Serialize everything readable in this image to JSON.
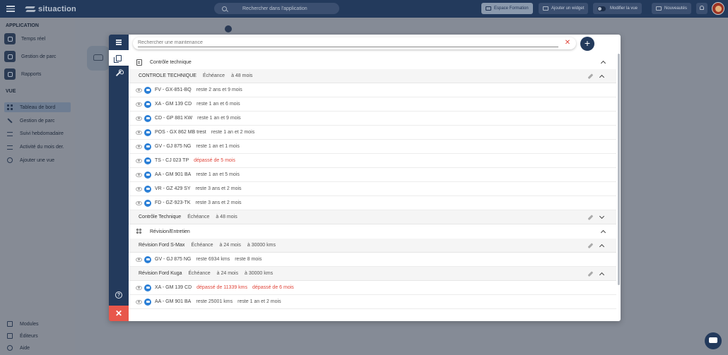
{
  "header": {
    "brand": "situaction",
    "search_placeholder": "Rechercher dans l'application",
    "buttons": {
      "training": "Espace Formation",
      "add_widget": "Ajouter un widget",
      "edit_view": "Modifier la vue",
      "news": "Nouveautés"
    }
  },
  "sidebar": {
    "application_title": "APPLICATION",
    "application_items": [
      "Temps réel",
      "Gestion de parc",
      "Rapports"
    ],
    "view_title": "VUE",
    "view_items": [
      "Tableau de bord",
      "Gestion de parc",
      "Suivi hebdomadaire",
      "Activité du mois der.",
      "Ajouter une vue"
    ],
    "bottom_items": [
      "Modules",
      "Éditeurs",
      "Aide"
    ]
  },
  "modal": {
    "search_placeholder": "Rechercher une maintenance",
    "groups": [
      {
        "title": "Contrôle technique",
        "maintenances": [
          {
            "name": "CONTROLE TECHNIQUE",
            "due_label": "Échéance",
            "due": [
              "à 48 mois"
            ],
            "vehicles": [
              {
                "plate": "FV - GX-851-BQ",
                "status": [
                  "reste 2 ans et 9 mois"
                ],
                "overdue": [
                  false
                ]
              },
              {
                "plate": "XA - GM 139 CD",
                "status": [
                  "reste 1 an et 6 mois"
                ],
                "overdue": [
                  false
                ]
              },
              {
                "plate": "CD - GP 881 KW",
                "status": [
                  "reste 1 an et 9 mois"
                ],
                "overdue": [
                  false
                ]
              },
              {
                "plate": "POS - GX 862 MB trest",
                "status": [
                  "reste 1 an et 2 mois"
                ],
                "overdue": [
                  false
                ]
              },
              {
                "plate": "GV - GJ 875 NG",
                "status": [
                  "reste 1 an et 1 mois"
                ],
                "overdue": [
                  false
                ]
              },
              {
                "plate": "TS - CJ 023 TP",
                "status": [
                  "dépassé de 5 mois"
                ],
                "overdue": [
                  true
                ]
              },
              {
                "plate": "AA - GM 901 BA",
                "status": [
                  "reste 1 an et 5 mois"
                ],
                "overdue": [
                  false
                ]
              },
              {
                "plate": "VR - GZ 429 SY",
                "status": [
                  "reste 3 ans et 2 mois"
                ],
                "overdue": [
                  false
                ]
              },
              {
                "plate": "FD - GZ-923-TK",
                "status": [
                  "reste 3 ans et 2 mois"
                ],
                "overdue": [
                  false
                ]
              }
            ]
          },
          {
            "name": "Contrôle Technique",
            "due_label": "Échéance",
            "due": [
              "à 48 mois"
            ],
            "vehicles": []
          }
        ]
      },
      {
        "title": "Révision/Entretien",
        "maintenances": [
          {
            "name": "Révision Ford S-Max",
            "due_label": "Échéance",
            "due": [
              "à 24 mois",
              "à 30000 kms"
            ],
            "vehicles": [
              {
                "plate": "GV - GJ 875 NG",
                "status": [
                  "reste 6934 kms",
                  "reste 8 mois"
                ],
                "overdue": [
                  false,
                  false
                ]
              }
            ]
          },
          {
            "name": "Révision Ford Kuga",
            "due_label": "Échéance",
            "due": [
              "à 24 mois",
              "à 30000 kms"
            ],
            "vehicles": [
              {
                "plate": "XA - GM 139 CD",
                "status": [
                  "dépassé de 11339 kms",
                  "dépassé de 6 mois"
                ],
                "overdue": [
                  true,
                  true
                ]
              },
              {
                "plate": "AA - GM 901 BA",
                "status": [
                  "reste 25001 kms",
                  "reste 1 an et 2 mois"
                ],
                "overdue": [
                  false,
                  false
                ]
              }
            ]
          }
        ]
      }
    ]
  }
}
